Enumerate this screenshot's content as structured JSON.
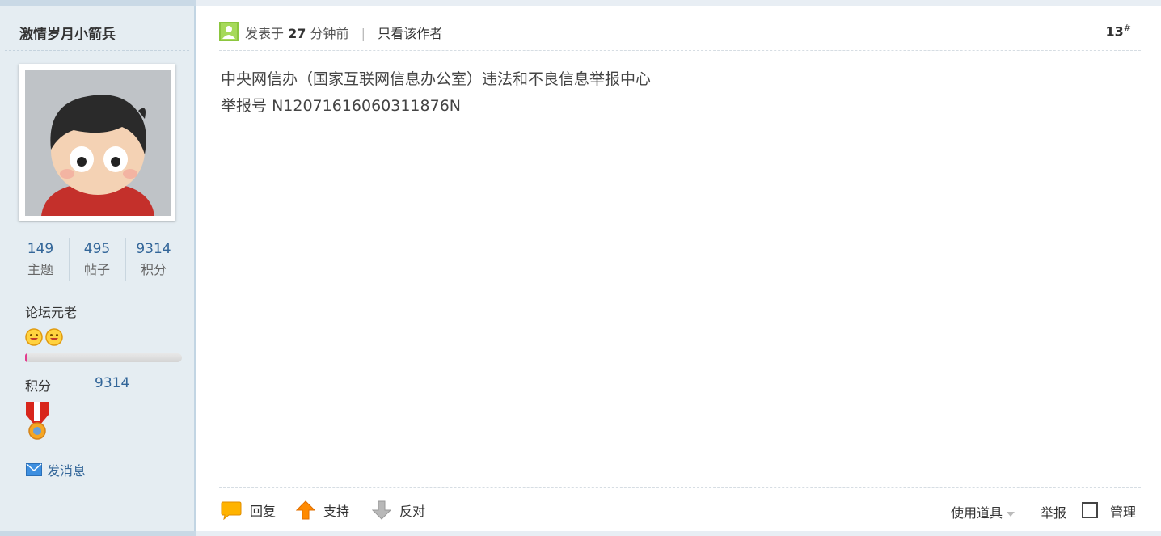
{
  "sidebar": {
    "username": "激情岁月小箭兵",
    "stats": [
      {
        "value": "149",
        "label": "主题"
      },
      {
        "value": "495",
        "label": "帖子"
      },
      {
        "value": "9314",
        "label": "积分"
      }
    ],
    "rank": "论坛元老",
    "rank_progress": 0.015,
    "credit_label": "积分",
    "credit_value": "9314",
    "send_message": "发消息"
  },
  "post": {
    "posted_prefix": "发表于",
    "posted_time": "27",
    "posted_suffix": "分钟前",
    "only_author": "只看该作者",
    "floor_number": "13",
    "floor_mark": "#",
    "content_line1": "中央网信办（国家互联网信息办公室）违法和不良信息举报中心",
    "content_line2_prefix": "举报号",
    "content_line2_code": "N12071616060311876N"
  },
  "actions": {
    "reply": "回复",
    "support": "支持",
    "oppose": "反对",
    "use_tool": "使用道具",
    "report": "举报",
    "manage": "管理"
  },
  "colors": {
    "sidebar_bg": "#e5edf2",
    "link_blue": "#336699",
    "progress_pink": "#e23c8e"
  }
}
